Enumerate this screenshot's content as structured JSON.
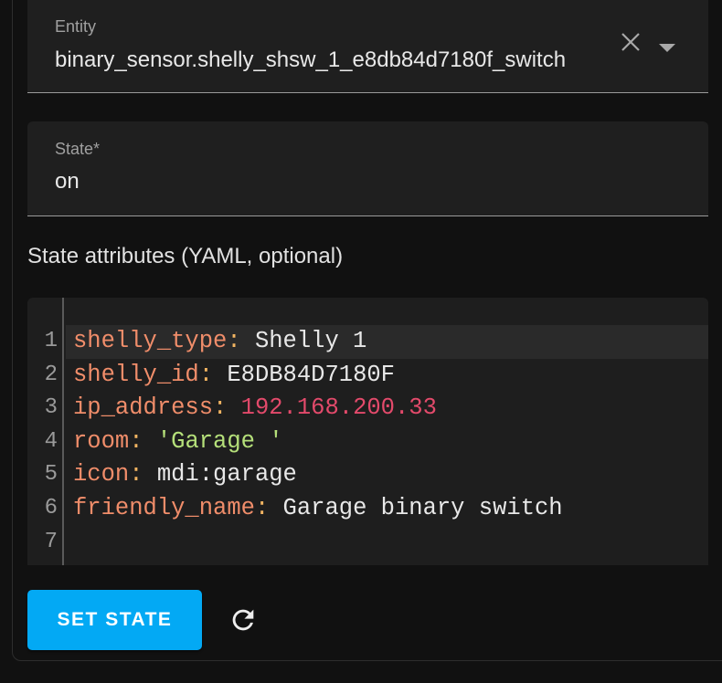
{
  "entity_field": {
    "label": "Entity",
    "value": "binary_sensor.shelly_shsw_1_e8db84d7180f_switch",
    "clear_icon": "close-icon",
    "dropdown_icon": "caret-down-icon"
  },
  "state_field": {
    "label": "State*",
    "value": "on"
  },
  "attributes_label": "State attributes (YAML, optional)",
  "editor": {
    "lines": [
      {
        "num": "1",
        "key": "shelly_type",
        "sep": ":",
        "val": " Shelly 1"
      },
      {
        "num": "2",
        "key": "shelly_id",
        "sep": ":",
        "val": " E8DB84D7180F"
      },
      {
        "num": "3",
        "key": "ip_address",
        "sep": ":",
        "val": " 192.168.200.33"
      },
      {
        "num": "4",
        "key": "room",
        "sep": ":",
        "val": " 'Garage '"
      },
      {
        "num": "5",
        "key": "icon",
        "sep": ":",
        "val": " mdi:garage"
      },
      {
        "num": "6",
        "key": "friendly_name",
        "sep": ":",
        "val": " Garage binary switch"
      },
      {
        "num": "7",
        "key": "",
        "sep": "",
        "val": ""
      }
    ]
  },
  "set_state_button": "SET STATE",
  "refresh_icon": "refresh-icon",
  "colors": {
    "accent": "#03a9f4",
    "yaml_key": "#f08d6a",
    "yaml_number": "#e34a6b",
    "yaml_string": "#b5e07a"
  }
}
